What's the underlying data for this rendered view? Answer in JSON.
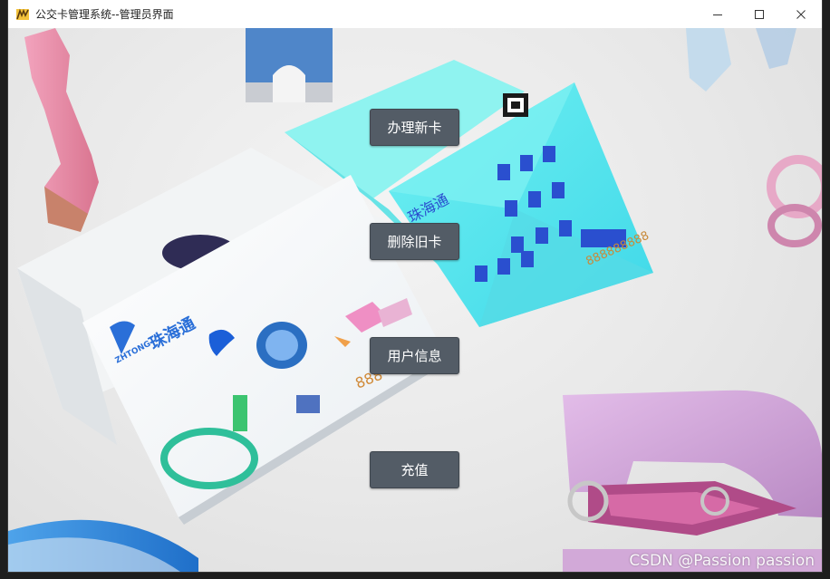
{
  "window": {
    "title": "公交卡管理系统--管理员界面",
    "controls": {
      "minimize_icon": "minimize-icon",
      "maximize_icon": "maximize-icon",
      "close_icon": "close-icon"
    }
  },
  "actions": {
    "new_card": "办理新卡",
    "delete_card": "删除旧卡",
    "user_info": "用户信息",
    "recharge": "充值"
  },
  "background": {
    "card_brand": "珠海通",
    "card_brand_en": "ZHTONG",
    "card_number_fragment": "888",
    "card_number_back": "888888888"
  },
  "watermark": "CSDN @Passion passion",
  "colors": {
    "button_bg": "#535c66",
    "button_text": "#ffffff",
    "titlebar_bg": "#ffffff"
  }
}
